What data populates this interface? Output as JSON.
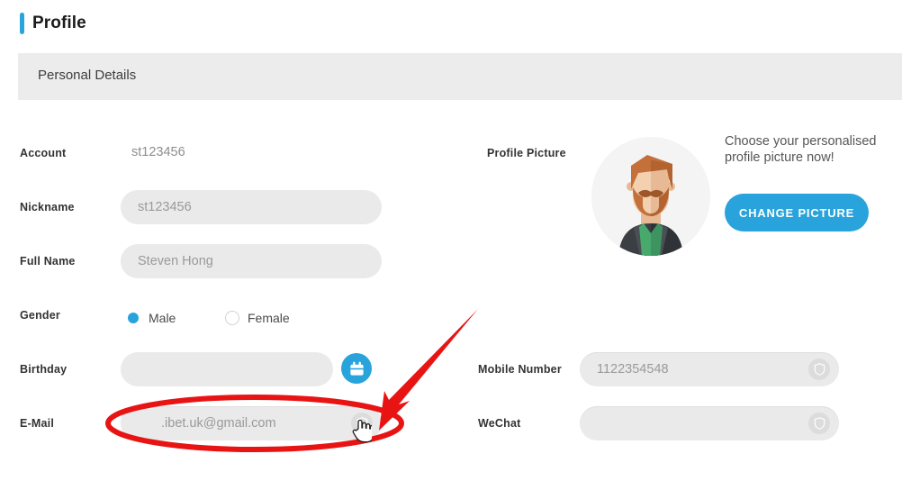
{
  "page": {
    "title": "Profile",
    "accent_color": "#29a3dc"
  },
  "section": {
    "label": "Personal Details",
    "background_color": "#ececec"
  },
  "form": {
    "left_fields": [
      {
        "label": "Account",
        "value": "st123456",
        "type": "static"
      },
      {
        "label": "Nickname",
        "value": "st123456",
        "type": "pill"
      },
      {
        "label": "Full Name",
        "value": "Steven Hong",
        "type": "pill"
      },
      {
        "label": "Gender",
        "value": "Male",
        "type": "radio"
      },
      {
        "label": "Birthday",
        "value": "",
        "type": "pill-calendar"
      },
      {
        "label": "E-Mail",
        "value": ".ibet.uk@gmail.com",
        "type": "pill-badge"
      }
    ],
    "right_fields": [
      {
        "label": "Mobile Number",
        "value": "1122354548",
        "type": "pill-badge"
      },
      {
        "label": "WeChat",
        "value": "",
        "type": "pill-badge"
      }
    ],
    "gender_options": [
      {
        "label": "Male",
        "selected": true
      },
      {
        "label": "Female",
        "selected": false
      }
    ],
    "input_background": "#eaeaea",
    "placeholder_color": "#9a9a9a"
  },
  "profile_picture": {
    "label": "Profile Picture",
    "promo_text": "Choose your personalised profile picture now!",
    "button_label": "CHANGE PICTURE",
    "button_color": "#29a3dc"
  },
  "annotation": {
    "highlight_color": "#e81414",
    "shape": "ellipse-around-email-field",
    "arrow": "red-arrow-pointing-to-email-icon",
    "cursor": "hand-pointer"
  }
}
